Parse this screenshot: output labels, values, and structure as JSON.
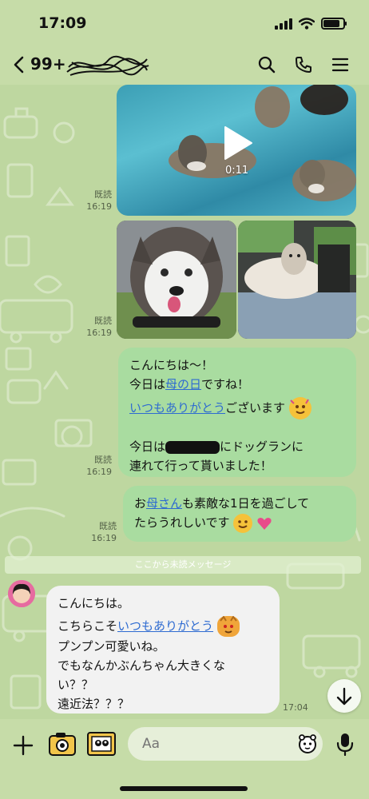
{
  "status_bar": {
    "time": "17:09",
    "battery_level_pct": 85
  },
  "header": {
    "back_count": "99+"
  },
  "messages": {
    "video": {
      "duration": "0:11"
    },
    "read_1": {
      "read": "既読",
      "time": "16:19"
    },
    "read_2": {
      "read": "既読",
      "time": "16:19"
    },
    "msg_1": {
      "line1": "こんにちは〜！",
      "line2a": "今日は",
      "line2_link": "母の日",
      "line2b": "ですね！",
      "line3_link": "いつもありがとう",
      "line3b": "ございます",
      "line4a": "今日は",
      "line4b": "にドッグランに",
      "line5": "連れて行って貰いました！",
      "read": "既読",
      "time": "16:19"
    },
    "msg_2": {
      "a": "お",
      "link": "母さん",
      "b": "も素敵な1日を過ごして",
      "line2": "たらうれしいです",
      "read": "既読",
      "time": "16:19"
    },
    "unread_separator": "ここから未読メッセージ",
    "msg_3": {
      "line1": "こんにちは。",
      "line2a": "こちらこそ",
      "line2_link": "いつもありがとう",
      "line3": "プンプン可愛いね。",
      "line4": "でもなんかぶんちゃん大きくな",
      "line5": "い？？",
      "line6": "遠近法？？？",
      "time": "17:04"
    }
  },
  "composer": {
    "placeholder": "Aa"
  },
  "colors": {
    "bubble_out": "#a9dca0",
    "bubble_in": "#f2f2f2",
    "background": "#bed7a0",
    "link": "#2e6bd1"
  },
  "icons": [
    "back-chevron-icon",
    "search-icon",
    "phone-icon",
    "menu-icon",
    "play-icon",
    "plus-icon",
    "camera-icon",
    "image-icon",
    "sticker-icon",
    "mic-icon",
    "scroll-down-icon"
  ]
}
